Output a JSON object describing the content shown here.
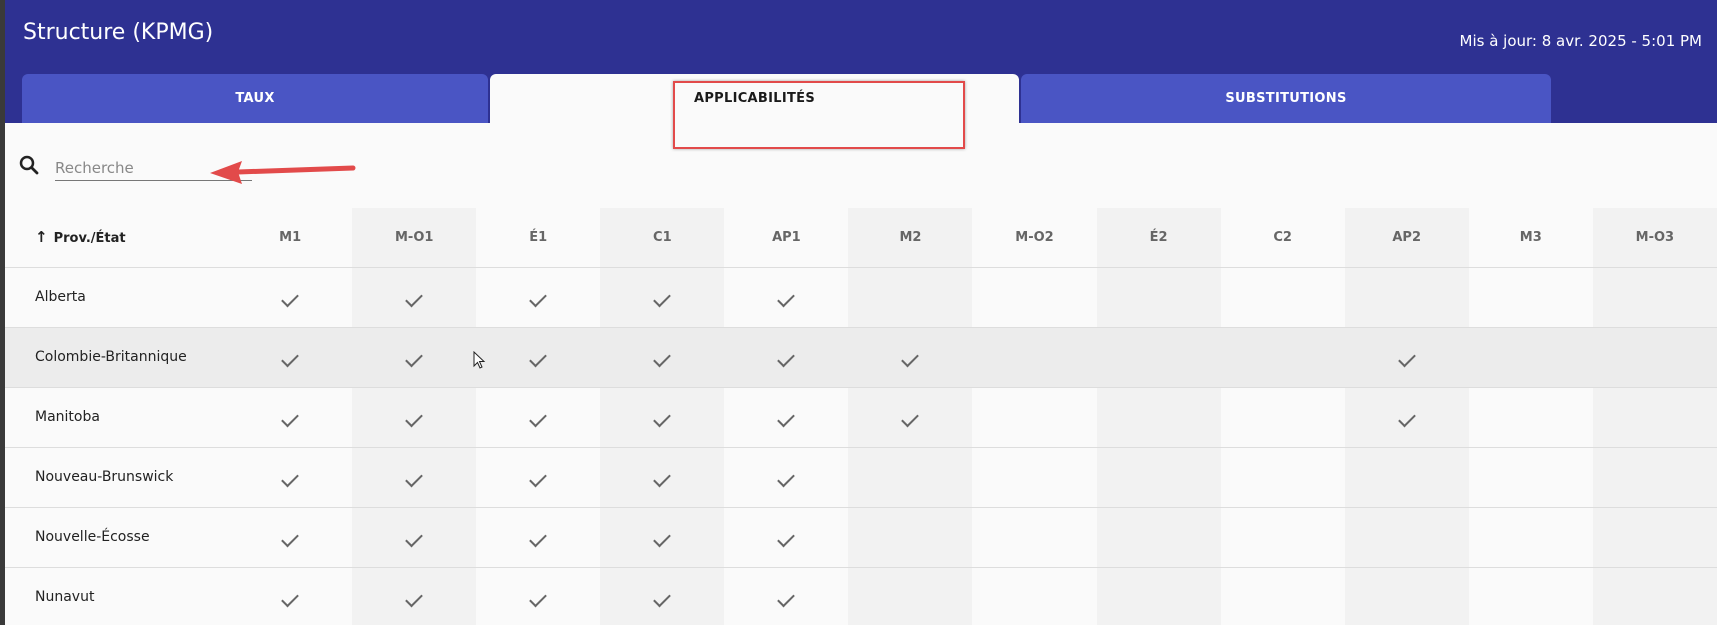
{
  "header": {
    "title": "Structure (KPMG)",
    "updated": "Mis à jour: 8 avr. 2025 - 5:01 PM"
  },
  "tabs": [
    {
      "label": "TAUX",
      "active": false
    },
    {
      "label": "APPLICABILITÉS",
      "active": true
    },
    {
      "label": "SUBSTITUTIONS",
      "active": false
    }
  ],
  "search": {
    "placeholder": "Recherche",
    "value": ""
  },
  "table": {
    "province_header": "Prov./État",
    "sort_icon": "arrow-up-icon",
    "columns": [
      "M1",
      "M-O1",
      "É1",
      "C1",
      "AP1",
      "M2",
      "M-O2",
      "É2",
      "C2",
      "AP2",
      "M3",
      "M-O3"
    ],
    "rows": [
      {
        "province": "Alberta",
        "checks": [
          true,
          true,
          true,
          true,
          true,
          false,
          false,
          false,
          false,
          false,
          false,
          false
        ]
      },
      {
        "province": "Colombie-Britannique",
        "checks": [
          true,
          true,
          true,
          true,
          true,
          true,
          false,
          false,
          false,
          true,
          false,
          false
        ]
      },
      {
        "province": "Manitoba",
        "checks": [
          true,
          true,
          true,
          true,
          true,
          true,
          false,
          false,
          false,
          true,
          false,
          false
        ]
      },
      {
        "province": "Nouveau-Brunswick",
        "checks": [
          true,
          true,
          true,
          true,
          true,
          false,
          false,
          false,
          false,
          false,
          false,
          false
        ]
      },
      {
        "province": "Nouvelle-Écosse",
        "checks": [
          true,
          true,
          true,
          true,
          true,
          false,
          false,
          false,
          false,
          false,
          false,
          false
        ]
      },
      {
        "province": "Nunavut",
        "checks": [
          true,
          true,
          true,
          true,
          true,
          false,
          false,
          false,
          false,
          false,
          false,
          false
        ]
      }
    ]
  },
  "colors": {
    "header_bg": "#2e3192",
    "tab_bg": "#4a55c4",
    "annotation": "#e24a4a"
  }
}
